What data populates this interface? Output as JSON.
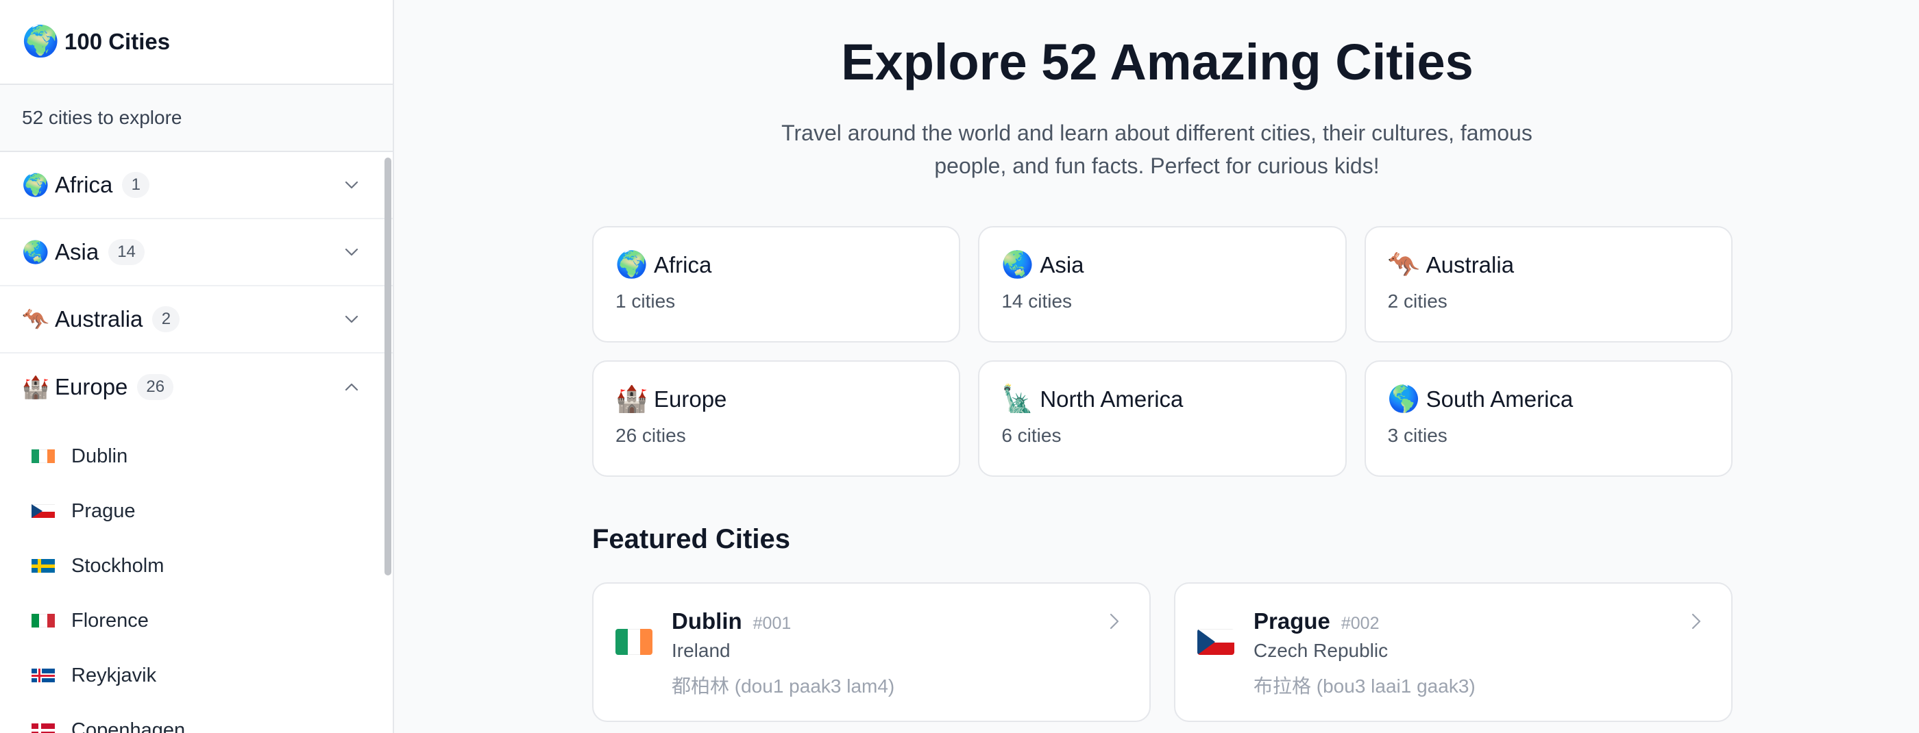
{
  "sidebar": {
    "logo_emoji": "🌍",
    "title": "100 Cities",
    "count_text": "52 cities to explore",
    "continents": [
      {
        "emoji": "🌍",
        "name": "Africa",
        "count": "1",
        "expanded": false
      },
      {
        "emoji": "🌏",
        "name": "Asia",
        "count": "14",
        "expanded": false
      },
      {
        "emoji": "🦘",
        "name": "Australia",
        "count": "2",
        "expanded": false
      },
      {
        "emoji": "🏰",
        "name": "Europe",
        "count": "26",
        "expanded": true
      }
    ],
    "europe_cities": [
      {
        "name": "Dublin",
        "flag_colors": [
          "#169b62",
          "#ffffff",
          "#ff883e"
        ]
      },
      {
        "name": "Prague",
        "flag_colors": [
          "#ffffff",
          "#d7141a",
          "#11457e"
        ]
      },
      {
        "name": "Stockholm",
        "flag_colors": [
          "#006aa7",
          "#fecc00"
        ]
      },
      {
        "name": "Florence",
        "flag_colors": [
          "#009246",
          "#ffffff",
          "#ce2b37"
        ]
      },
      {
        "name": "Reykjavik",
        "flag_colors": [
          "#02529c",
          "#ffffff",
          "#dc1e35"
        ]
      },
      {
        "name": "Copenhagen",
        "flag_colors": [
          "#c8102e",
          "#ffffff"
        ]
      }
    ]
  },
  "main": {
    "title": "Explore 52 Amazing Cities",
    "subtitle": "Travel around the world and learn about different cities, their cultures, famous people, and fun facts. Perfect for curious kids!",
    "continent_cards": [
      {
        "emoji": "🌍",
        "name": "Africa",
        "count_text": "1 cities"
      },
      {
        "emoji": "🌏",
        "name": "Asia",
        "count_text": "14 cities"
      },
      {
        "emoji": "🦘",
        "name": "Australia",
        "count_text": "2 cities"
      },
      {
        "emoji": "🏰",
        "name": "Europe",
        "count_text": "26 cities"
      },
      {
        "emoji": "🗽",
        "name": "North America",
        "count_text": "6 cities"
      },
      {
        "emoji": "🌎",
        "name": "South America",
        "count_text": "3 cities"
      }
    ],
    "featured_title": "Featured Cities",
    "featured": [
      {
        "city": "Dublin",
        "number": "#001",
        "country": "Ireland",
        "chinese": "都柏林 (dou1 paak3 lam4)",
        "flag_colors": [
          "#169b62",
          "#ffffff",
          "#ff883e"
        ]
      },
      {
        "city": "Prague",
        "number": "#002",
        "country": "Czech Republic",
        "chinese": "布拉格 (bou3 laai1 gaak3)",
        "flag_colors": [
          "#ffffff",
          "#d7141a",
          "#11457e"
        ]
      }
    ]
  },
  "colors": {
    "text_primary": "#111827",
    "text_secondary": "#4b5563",
    "text_muted": "#9ca3af",
    "border": "#e5e7eb",
    "page_bg": "#f9fafb"
  },
  "icons": {
    "chevron_collapsed": "chevron-down-icon",
    "chevron_expanded": "chevron-up-icon",
    "card_arrow": "chevron-right-icon"
  }
}
